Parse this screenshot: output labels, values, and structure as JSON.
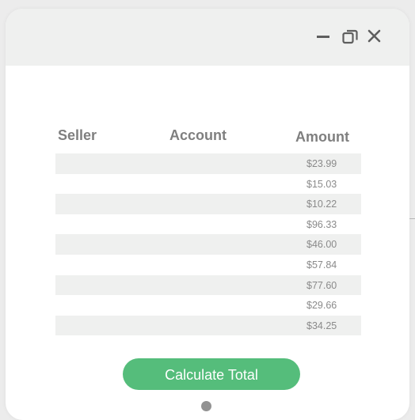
{
  "window": {
    "controls": {
      "minimize_icon": "minimize-icon",
      "restore_icon": "restore-icon",
      "close_icon": "close-icon"
    }
  },
  "table": {
    "headers": {
      "seller": "Seller",
      "account": "Account",
      "amount": "Amount"
    },
    "rows": [
      {
        "seller": "",
        "account": "",
        "amount": "$23.99"
      },
      {
        "seller": "",
        "account": "",
        "amount": "$15.03"
      },
      {
        "seller": "",
        "account": "",
        "amount": "$10.22"
      },
      {
        "seller": "",
        "account": "",
        "amount": "$96.33"
      },
      {
        "seller": "",
        "account": "",
        "amount": "$46.00"
      },
      {
        "seller": "",
        "account": "",
        "amount": "$57.84"
      },
      {
        "seller": "",
        "account": "",
        "amount": "$77.60"
      },
      {
        "seller": "",
        "account": "",
        "amount": "$29.66"
      },
      {
        "seller": "",
        "account": "",
        "amount": "$34.25"
      }
    ]
  },
  "actions": {
    "calculate_label": "Calculate Total"
  },
  "colors": {
    "accent": "#55bd7b",
    "stripe": "#eff0ef",
    "titlebar": "#eff0ef"
  }
}
